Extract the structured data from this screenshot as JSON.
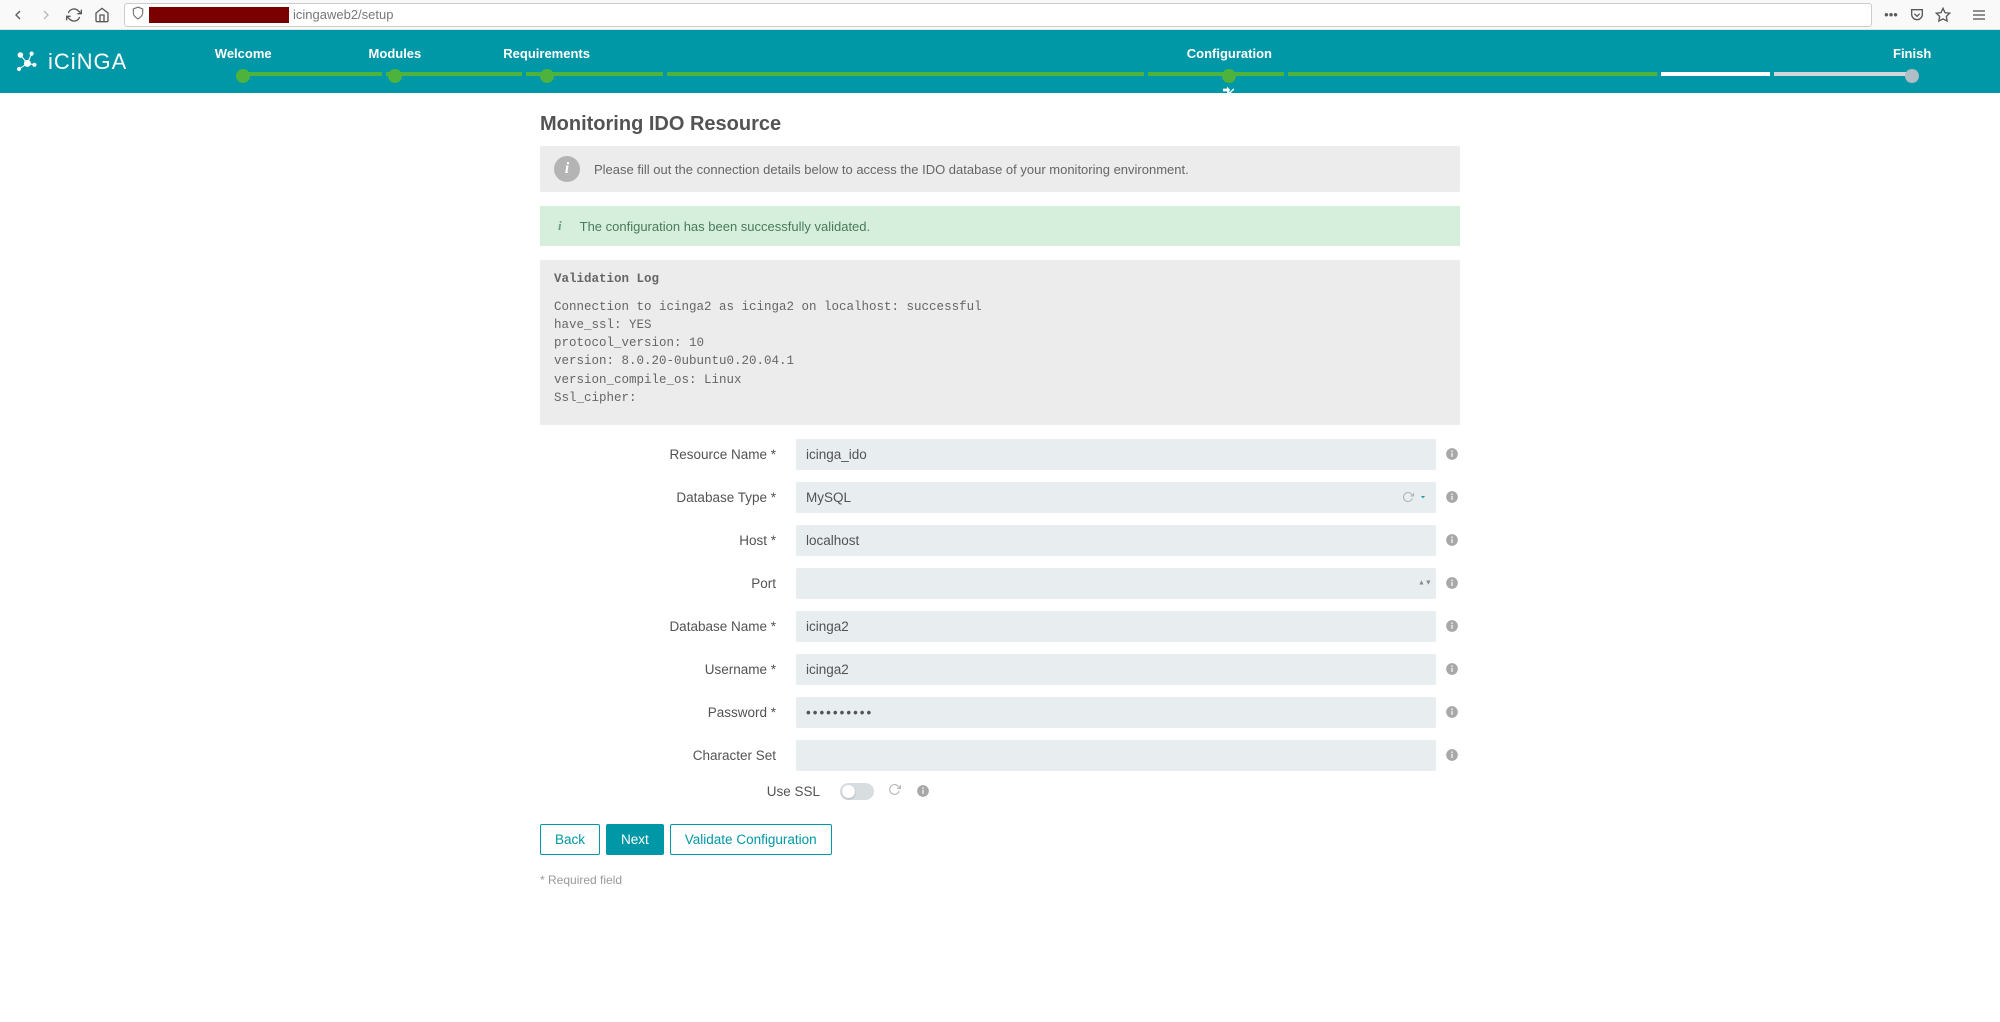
{
  "browser": {
    "url_path": "icingaweb2/setup"
  },
  "header": {
    "brand": "iCiNGA",
    "steps": [
      {
        "label": "Welcome",
        "state": "done"
      },
      {
        "label": "Modules",
        "state": "done"
      },
      {
        "label": "Requirements",
        "state": "done"
      },
      {
        "label": "",
        "state": "done"
      },
      {
        "label": "Configuration",
        "state": "current"
      },
      {
        "label": "",
        "state": "done"
      },
      {
        "label": "Finish",
        "state": "pending"
      }
    ]
  },
  "page": {
    "title": "Monitoring IDO Resource",
    "info": "Please fill out the connection details below to access the IDO database of your monitoring environment.",
    "success": "The configuration has been successfully validated.",
    "log_title": "Validation Log",
    "log_body": "Connection to icinga2 as icinga2 on localhost: successful\nhave_ssl: YES\nprotocol_version: 10\nversion: 8.0.20-0ubuntu0.20.04.1\nversion_compile_os: Linux\nSsl_cipher:"
  },
  "form": {
    "resource_name": {
      "label": "Resource Name *",
      "value": "icinga_ido"
    },
    "database_type": {
      "label": "Database Type *",
      "value": "MySQL"
    },
    "host": {
      "label": "Host *",
      "value": "localhost"
    },
    "port": {
      "label": "Port",
      "value": ""
    },
    "database_name": {
      "label": "Database Name *",
      "value": "icinga2"
    },
    "username": {
      "label": "Username *",
      "value": "icinga2"
    },
    "password": {
      "label": "Password *",
      "value": "••••••••••"
    },
    "character_set": {
      "label": "Character Set",
      "value": ""
    },
    "use_ssl": {
      "label": "Use SSL",
      "value": false
    }
  },
  "buttons": {
    "back": "Back",
    "next": "Next",
    "validate": "Validate Configuration"
  },
  "footer": {
    "required": "* Required field"
  }
}
